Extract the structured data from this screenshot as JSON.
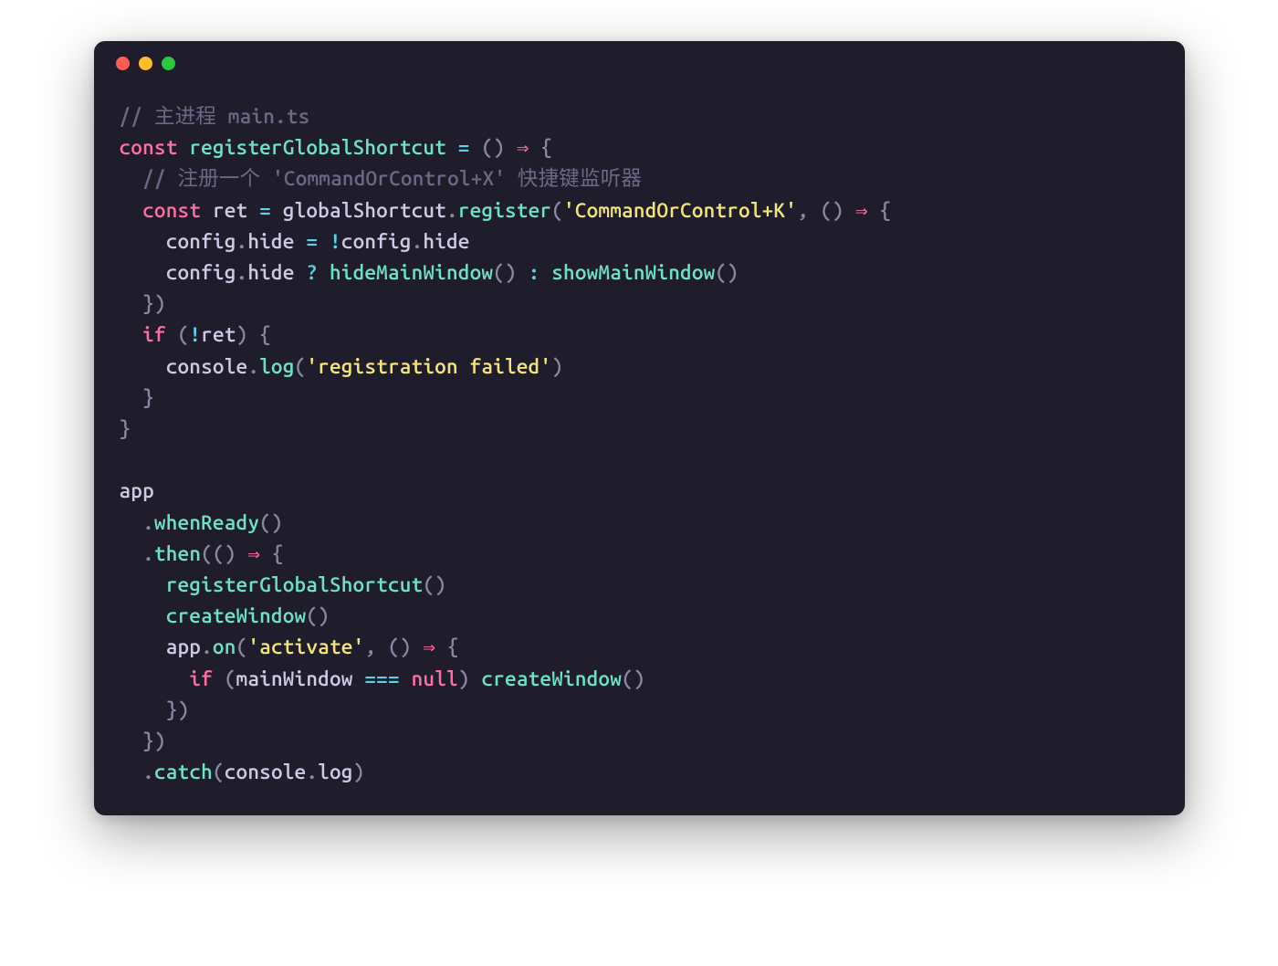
{
  "colors": {
    "background": "#1f1d2c",
    "comment": "#6b6785",
    "keyword": "#ff6ea0",
    "function": "#6de3c2",
    "identifier": "#cfc9e6",
    "operator": "#5fd0e6",
    "punctuation": "#8b87a3",
    "string": "#f3e47c",
    "traffic_red": "#ff5f56",
    "traffic_yellow": "#ffbd2e",
    "traffic_green": "#27c93f"
  },
  "code": {
    "c1": "// 主进程 main.ts",
    "kw_const1": "const",
    "fn_reg": "registerGlobalShortcut",
    "op_eq": "=",
    "p_lparen": "(",
    "p_rparen": ")",
    "arrow": "⇒",
    "p_lbrace": "{",
    "c2": "// 注册一个 'CommandOrControl+X' 快捷键监听器",
    "kw_const2": "const",
    "id_ret": "ret",
    "id_globalShortcut": "globalShortcut",
    "p_dot": ".",
    "fn_register": "register",
    "str_cmdk": "'CommandOrControl+K'",
    "p_comma": ",",
    "id_config": "config",
    "id_hide": "hide",
    "op_bang": "!",
    "op_q": "?",
    "fn_hideMainWindow": "hideMainWindow",
    "op_colon": ":",
    "fn_showMainWindow": "showMainWindow",
    "p_rbrace": "}",
    "kw_if": "if",
    "id_console": "console",
    "fn_log": "log",
    "str_regfail": "'registration failed'",
    "id_app": "app",
    "fn_whenReady": "whenReady",
    "fn_then": "then",
    "fn_createWindow": "createWindow",
    "fn_on": "on",
    "str_activate": "'activate'",
    "id_mainWindow": "mainWindow",
    "op_eqeqeq": "===",
    "nl_null": "null",
    "fn_catch": "catch",
    "id_consolelog": "log"
  }
}
